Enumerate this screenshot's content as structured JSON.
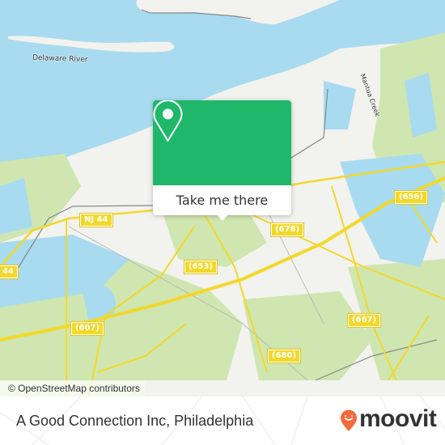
{
  "map": {
    "water_labels": [
      "Delaware River",
      "Mantua Creek"
    ],
    "road_shields": [
      {
        "label": "NJ 44"
      },
      {
        "label": "44"
      },
      {
        "label": "(656)"
      },
      {
        "label": "(678)"
      },
      {
        "label": "(653)"
      },
      {
        "label": "(607)"
      },
      {
        "label": "(667)"
      },
      {
        "label": "(680)"
      }
    ],
    "attribution": "© OpenStreetMap contributors",
    "colors": {
      "water": "#a8dbef",
      "land": "#f2f2ee",
      "park": "#cfe6b0",
      "road": "#f3d82a",
      "rail": "#888888"
    }
  },
  "popup": {
    "icon": "map-pin-icon",
    "button_label": "Take me there",
    "accent": "#1fb86a"
  },
  "footer": {
    "place_name": "A Good Connection Inc, Philadelphia",
    "brand": "moovit",
    "brand_color": "#f26b3a"
  }
}
